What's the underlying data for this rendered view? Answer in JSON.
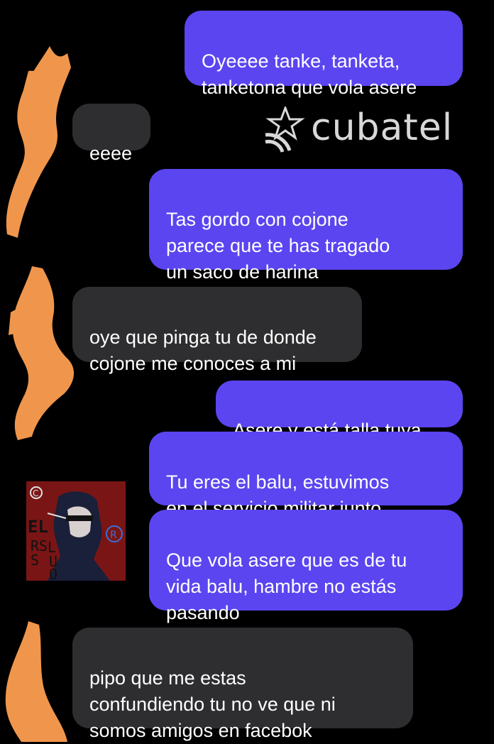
{
  "chat": {
    "messages": [
      {
        "side": "sent",
        "text": "Oyeeee tanke, tanketa,\ntanketona que vola asere"
      },
      {
        "side": "received",
        "text": "eeee"
      },
      {
        "side": "sent",
        "text": "Tas gordo con cojone\nparece que te has tragado\nun saco de harina"
      },
      {
        "side": "received",
        "text": "oye que pinga tu de donde\ncojone me conoces a mi"
      },
      {
        "side": "sent",
        "text": "Asere y está talla tuya"
      },
      {
        "side": "sent",
        "text": "Tu eres el balu, estuvimos\nen el servicio militar junto"
      },
      {
        "side": "sent",
        "text": "Que vola asere que es de tu\nvida balu, hambre no estás\npasando"
      },
      {
        "side": "received",
        "text": "pipo que me estas\nconfundiendo tu no ve que ni\nsomos amigos en facebok"
      }
    ]
  },
  "watermark": {
    "brand": "cubatel",
    "icon": "cubatel-star-wifi-logo"
  },
  "avatar_stamp": {
    "letters": "EL RS LUO",
    "icon": "anime-avatar-stamp"
  },
  "colors": {
    "sent_bubble": "#5b45f0",
    "received_bubble": "#2e2e30",
    "background": "#000000",
    "redaction": "#f0964c"
  }
}
